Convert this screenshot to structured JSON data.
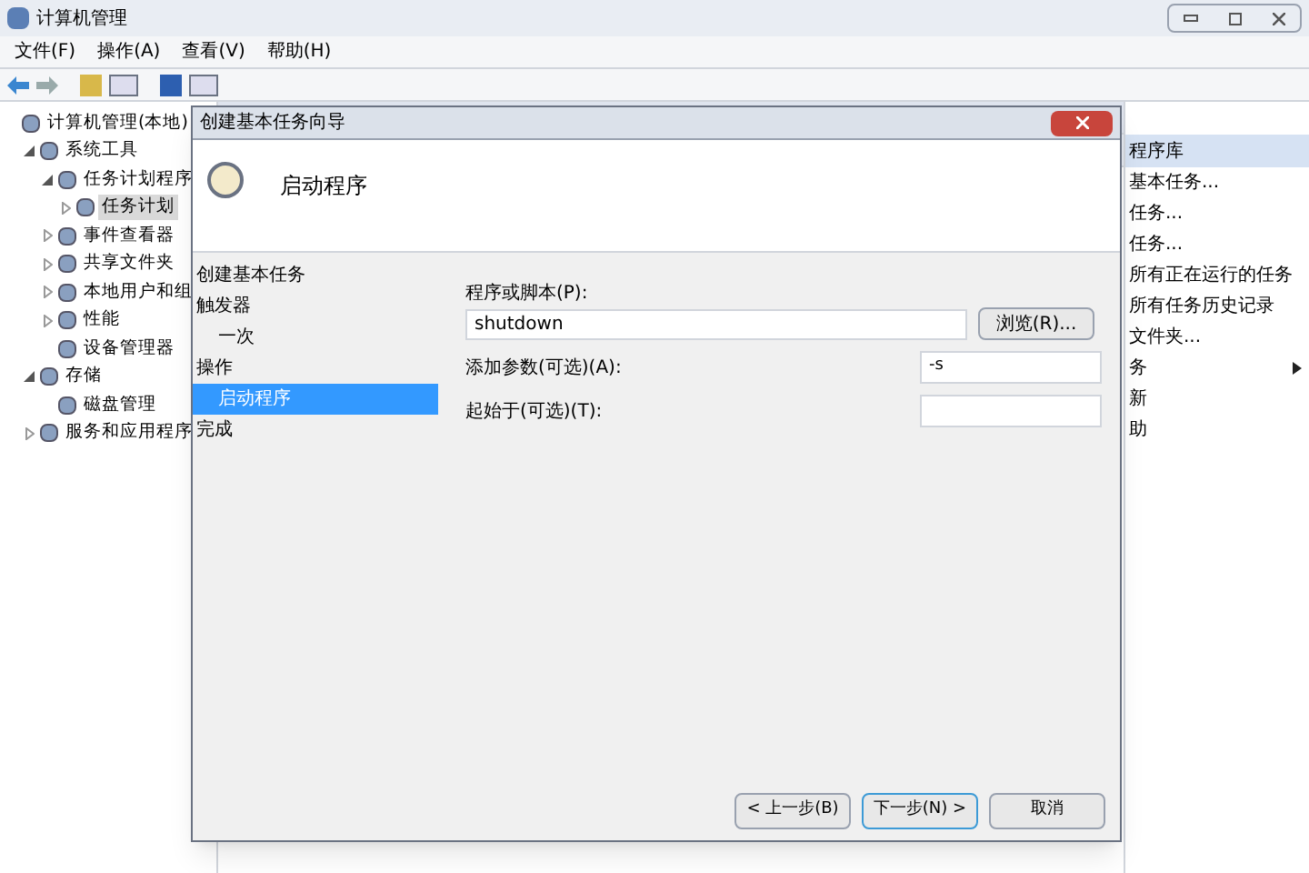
{
  "window": {
    "title": "计算机管理"
  },
  "menu": [
    "文件(F)",
    "操作(A)",
    "查看(V)",
    "帮助(H)"
  ],
  "tree": [
    {
      "label": "计算机管理(本地)",
      "selected": false,
      "children": [
        {
          "label": "系统工具",
          "expanded": true,
          "selected": false,
          "children": [
            {
              "label": "任务计划程序",
              "expanded": true,
              "selected": false,
              "children": [
                {
                  "label": "任务计划",
                  "expanded": false,
                  "selected": true
                }
              ]
            },
            {
              "label": "事件查看器",
              "expanded": false,
              "selected": false
            },
            {
              "label": "共享文件夹",
              "expanded": false,
              "selected": false
            },
            {
              "label": "本地用户和组",
              "expanded": false,
              "selected": false
            },
            {
              "label": "性能",
              "expanded": false,
              "selected": false
            },
            {
              "label": "设备管理器",
              "selected": false
            }
          ]
        },
        {
          "label": "存储",
          "expanded": true,
          "selected": false,
          "children": [
            {
              "label": "磁盘管理",
              "selected": false
            }
          ]
        },
        {
          "label": "服务和应用程序",
          "expanded": false,
          "selected": false
        }
      ]
    }
  ],
  "actions": {
    "header": "程序库",
    "items": [
      {
        "label": "基本任务...",
        "submenu": false
      },
      {
        "label": "任务...",
        "submenu": false
      },
      {
        "label": "任务...",
        "submenu": false
      },
      {
        "label": "所有正在运行的任务",
        "submenu": false
      },
      {
        "label": "所有任务历史记录",
        "submenu": false
      },
      {
        "label": "文件夹...",
        "submenu": false
      },
      {
        "label": "务",
        "submenu": true
      },
      {
        "label": "新",
        "submenu": false
      },
      {
        "label": "助",
        "submenu": false
      }
    ]
  },
  "dialog": {
    "title": "创建基本任务向导",
    "heading": "启动程序",
    "steps": [
      {
        "label": "创建基本任务",
        "selected": false
      },
      {
        "label": "触发器",
        "selected": false,
        "children": [
          {
            "label": "一次",
            "selected": false
          }
        ]
      },
      {
        "label": "操作",
        "selected": false,
        "children": [
          {
            "label": "启动程序",
            "selected": true
          }
        ]
      },
      {
        "label": "完成",
        "selected": false
      }
    ],
    "program": {
      "label": "程序或脚本(P):",
      "value": "shutdown",
      "browse": "浏览(R)..."
    },
    "arguments": {
      "label": "添加参数(可选)(A):",
      "value": "-s"
    },
    "start_in": {
      "label": "起始于(可选)(T):"
    },
    "buttons": [
      {
        "label": "< 上一步(B)",
        "default": false
      },
      {
        "label": "下一步(N) >",
        "default": true
      },
      {
        "label": "取消",
        "default": false
      }
    ]
  }
}
